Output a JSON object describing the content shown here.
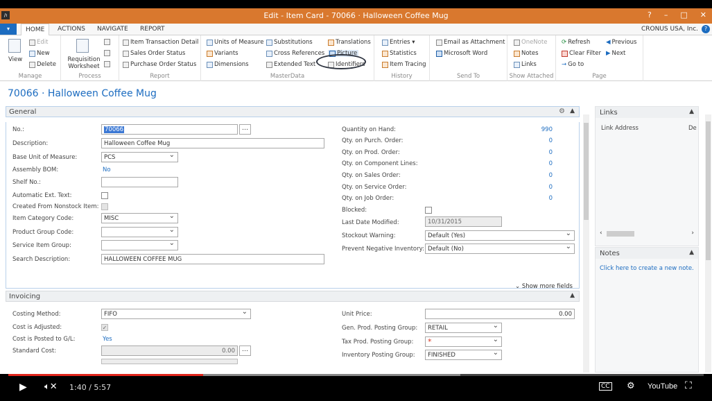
{
  "window": {
    "title": "Edit - Item Card - 70066 · Halloween Coffee Mug",
    "controls": [
      "?",
      "–",
      "□",
      "✕"
    ]
  },
  "ribbon": {
    "tabs": [
      "HOME",
      "ACTIONS",
      "NAVIGATE",
      "REPORT"
    ],
    "active_tab": "HOME",
    "company": "CRONUS USA, Inc.",
    "groups": {
      "manage": {
        "label": "Manage",
        "view": "View",
        "edit": "Edit",
        "new": "New",
        "delete": "Delete"
      },
      "process": {
        "label": "Process",
        "requisition": "Requisition Worksheet"
      },
      "report": {
        "label": "Report",
        "items": [
          "Item Transaction Detail",
          "Sales Order Status",
          "Purchase Order Status"
        ]
      },
      "masterdata": {
        "label": "MasterData",
        "items": [
          "Units of Measure",
          "Variants",
          "Dimensions",
          "Substitutions",
          "Cross References",
          "Extended Text",
          "Translations",
          "Picture",
          "Identifiers"
        ]
      },
      "history": {
        "label": "History",
        "items": [
          "Entries ▾",
          "Statistics",
          "Item Tracing"
        ]
      },
      "sendto": {
        "label": "Send To",
        "items": [
          "Email as Attachment",
          "Microsoft Word"
        ]
      },
      "showattached": {
        "label": "Show Attached",
        "items": [
          "OneNote",
          "Notes",
          "Links"
        ]
      },
      "page": {
        "label": "Page",
        "items": [
          "Refresh",
          "Clear Filter",
          "Go to",
          "Previous",
          "Next"
        ]
      }
    }
  },
  "page": {
    "header": "70066 · Halloween Coffee Mug"
  },
  "general": {
    "title": "General",
    "no_label": "No.:",
    "no_value": "70066",
    "description_label": "Description:",
    "description_value": "Halloween Coffee Mug",
    "base_uom_label": "Base Unit of Measure:",
    "base_uom_value": "PCS",
    "assembly_bom_label": "Assembly BOM:",
    "assembly_bom_value": "No",
    "shelf_no_label": "Shelf No.:",
    "shelf_no_value": "",
    "auto_ext_text_label": "Automatic Ext. Text:",
    "nonstock_label": "Created From Nonstock Item:",
    "item_category_label": "Item Category Code:",
    "item_category_value": "MISC",
    "product_group_label": "Product Group Code:",
    "product_group_value": "",
    "service_item_group_label": "Service Item Group:",
    "service_item_group_value": "",
    "search_desc_label": "Search Description:",
    "search_desc_value": "HALLOWEEN COFFEE MUG",
    "qty_on_hand_label": "Quantity on Hand:",
    "qty_on_hand_value": "990",
    "qty_purch_label": "Qty. on Purch. Order:",
    "qty_purch_value": "0",
    "qty_prod_label": "Qty. on Prod. Order:",
    "qty_prod_value": "0",
    "qty_comp_label": "Qty. on Component Lines:",
    "qty_comp_value": "0",
    "qty_sales_label": "Qty. on Sales Order:",
    "qty_sales_value": "0",
    "qty_service_label": "Qty. on Service Order:",
    "qty_service_value": "0",
    "qty_job_label": "Qty. on Job Order:",
    "qty_job_value": "0",
    "blocked_label": "Blocked:",
    "last_modified_label": "Last Date Modified:",
    "last_modified_value": "10/31/2015",
    "stockout_label": "Stockout Warning:",
    "stockout_value": "Default (Yes)",
    "prevent_neg_label": "Prevent Negative Inventory:",
    "prevent_neg_value": "Default (No)",
    "show_more": "Show more fields"
  },
  "invoicing": {
    "title": "Invoicing",
    "costing_method_label": "Costing Method:",
    "costing_method_value": "FIFO",
    "cost_adjusted_label": "Cost is Adjusted:",
    "cost_posted_label": "Cost is Posted to G/L:",
    "cost_posted_value": "Yes",
    "standard_cost_label": "Standard Cost:",
    "standard_cost_value": "0.00",
    "unit_price_label": "Unit Price:",
    "unit_price_value": "0.00",
    "gen_prod_label": "Gen. Prod. Posting Group:",
    "gen_prod_value": "RETAIL",
    "tax_prod_label": "Tax Prod. Posting Group:",
    "tax_prod_value": "*",
    "inv_posting_label": "Inventory Posting Group:",
    "inv_posting_value": "FINISHED"
  },
  "factbox": {
    "links_title": "Links",
    "links_col1": "Link Address",
    "links_col2": "De",
    "notes_title": "Notes",
    "notes_link": "Click here to create a new note."
  },
  "player": {
    "time": "1:40 / 5:57",
    "progress": 0.28,
    "buffered": 0.65
  }
}
